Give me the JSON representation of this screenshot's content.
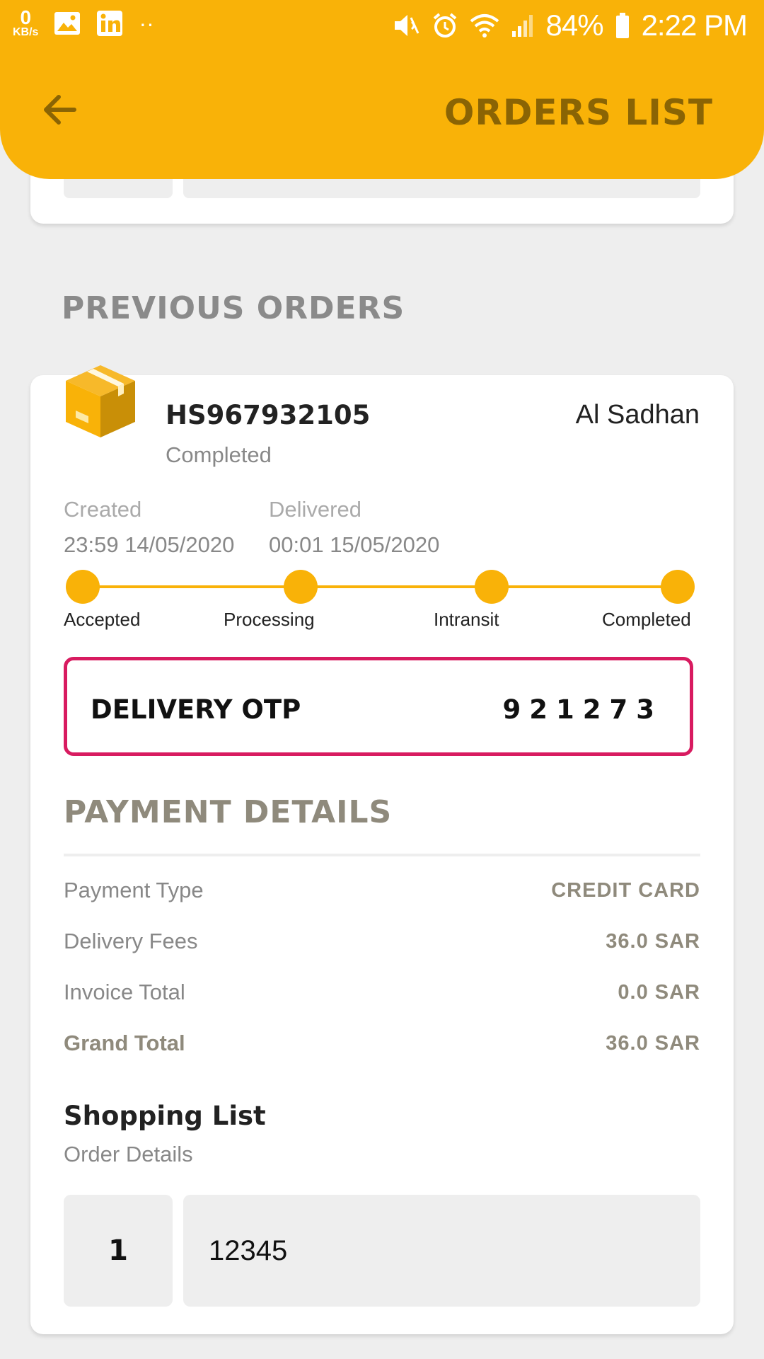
{
  "status_bar": {
    "kbs_value": "0",
    "kbs_unit": "KB/s",
    "dots": "··",
    "battery": "84%",
    "time": "2:22 PM"
  },
  "header": {
    "title": "ORDERS LIST",
    "back_icon": "arrow-left-icon",
    "color": "#f9b208"
  },
  "section_title": "PREVIOUS ORDERS",
  "order": {
    "id": "HS967932105",
    "status": "Completed",
    "store": "Al Sadhan",
    "created_label": "Created",
    "created_value": "23:59 14/05/2020",
    "delivered_label": "Delivered",
    "delivered_value": "00:01 15/05/2020",
    "steps": [
      "Accepted",
      "Processing",
      "Intransit",
      "Completed"
    ],
    "otp_label": "DELIVERY OTP",
    "otp_value": "921273",
    "otp_border_color": "#d81b60"
  },
  "payment": {
    "title": "PAYMENT DETAILS",
    "rows": [
      {
        "label": "Payment Type",
        "value": "CREDIT CARD"
      },
      {
        "label": "Delivery Fees",
        "value": "36.0 SAR"
      },
      {
        "label": "Invoice Total",
        "value": "0.0 SAR"
      },
      {
        "label": "Grand Total",
        "value": "36.0 SAR"
      }
    ]
  },
  "shopping": {
    "title": "Shopping List",
    "subtitle": "Order Details",
    "items": [
      {
        "qty": "1",
        "name": "12345"
      }
    ]
  }
}
